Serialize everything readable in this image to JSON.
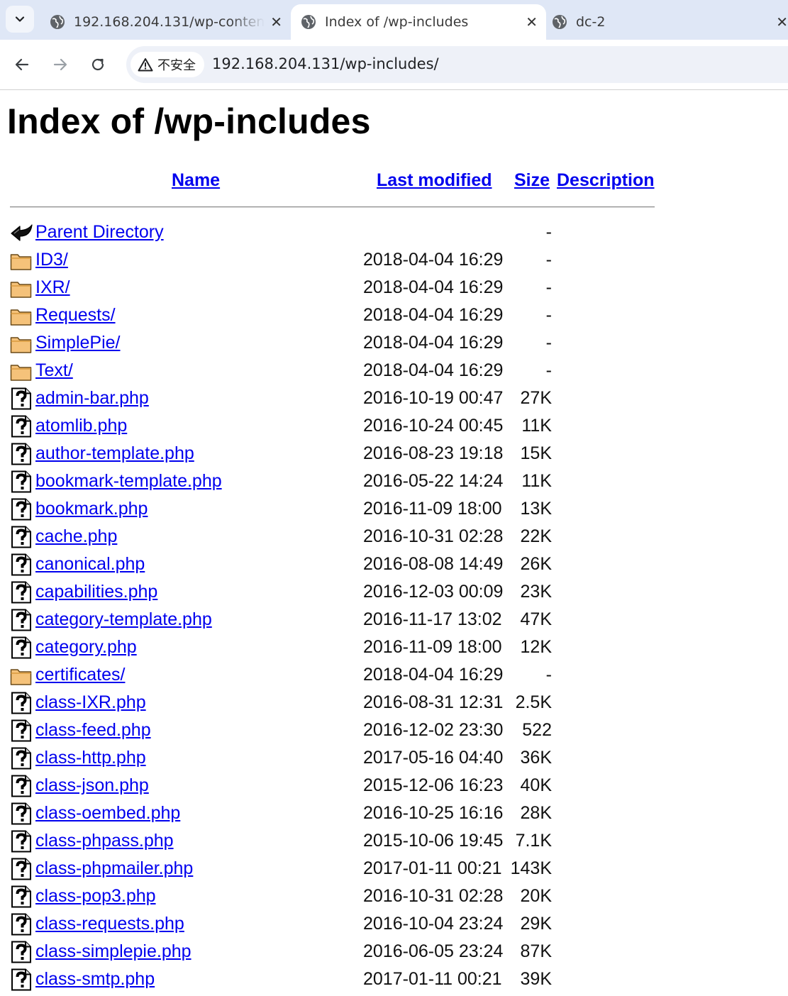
{
  "browser": {
    "tabs": [
      {
        "title": "192.168.204.131/wp-content",
        "active": false
      },
      {
        "title": "Index of /wp-includes",
        "active": true
      },
      {
        "title": "dc-2",
        "active": false
      }
    ],
    "security_label": "不安全",
    "url": "192.168.204.131/wp-includes/"
  },
  "page": {
    "title": "Index of /wp-includes",
    "columns": {
      "name": "Name",
      "last_modified": "Last modified",
      "size": "Size",
      "description": "Description"
    },
    "rows": [
      {
        "icon": "back-icon",
        "name": "Parent Directory",
        "date": "",
        "size": "-"
      },
      {
        "icon": "folder-icon",
        "name": "ID3/",
        "date": "2018-04-04 16:29",
        "size": "-"
      },
      {
        "icon": "folder-icon",
        "name": "IXR/",
        "date": "2018-04-04 16:29",
        "size": "-"
      },
      {
        "icon": "folder-icon",
        "name": "Requests/",
        "date": "2018-04-04 16:29",
        "size": "-"
      },
      {
        "icon": "folder-icon",
        "name": "SimplePie/",
        "date": "2018-04-04 16:29",
        "size": "-"
      },
      {
        "icon": "folder-icon",
        "name": "Text/",
        "date": "2018-04-04 16:29",
        "size": "-"
      },
      {
        "icon": "unknown-file-icon",
        "name": "admin-bar.php",
        "date": "2016-10-19 00:47",
        "size": "27K"
      },
      {
        "icon": "unknown-file-icon",
        "name": "atomlib.php",
        "date": "2016-10-24 00:45",
        "size": "11K"
      },
      {
        "icon": "unknown-file-icon",
        "name": "author-template.php",
        "date": "2016-08-23 19:18",
        "size": "15K"
      },
      {
        "icon": "unknown-file-icon",
        "name": "bookmark-template.php",
        "date": "2016-05-22 14:24",
        "size": "11K"
      },
      {
        "icon": "unknown-file-icon",
        "name": "bookmark.php",
        "date": "2016-11-09 18:00",
        "size": "13K"
      },
      {
        "icon": "unknown-file-icon",
        "name": "cache.php",
        "date": "2016-10-31 02:28",
        "size": "22K"
      },
      {
        "icon": "unknown-file-icon",
        "name": "canonical.php",
        "date": "2016-08-08 14:49",
        "size": "26K"
      },
      {
        "icon": "unknown-file-icon",
        "name": "capabilities.php",
        "date": "2016-12-03 00:09",
        "size": "23K"
      },
      {
        "icon": "unknown-file-icon",
        "name": "category-template.php",
        "date": "2016-11-17 13:02",
        "size": "47K"
      },
      {
        "icon": "unknown-file-icon",
        "name": "category.php",
        "date": "2016-11-09 18:00",
        "size": "12K"
      },
      {
        "icon": "folder-icon",
        "name": "certificates/",
        "date": "2018-04-04 16:29",
        "size": "-"
      },
      {
        "icon": "unknown-file-icon",
        "name": "class-IXR.php",
        "date": "2016-08-31 12:31",
        "size": "2.5K"
      },
      {
        "icon": "unknown-file-icon",
        "name": "class-feed.php",
        "date": "2016-12-02 23:30",
        "size": "522"
      },
      {
        "icon": "unknown-file-icon",
        "name": "class-http.php",
        "date": "2017-05-16 04:40",
        "size": "36K"
      },
      {
        "icon": "unknown-file-icon",
        "name": "class-json.php",
        "date": "2015-12-06 16:23",
        "size": "40K"
      },
      {
        "icon": "unknown-file-icon",
        "name": "class-oembed.php",
        "date": "2016-10-25 16:16",
        "size": "28K"
      },
      {
        "icon": "unknown-file-icon",
        "name": "class-phpass.php",
        "date": "2015-10-06 19:45",
        "size": "7.1K"
      },
      {
        "icon": "unknown-file-icon",
        "name": "class-phpmailer.php",
        "date": "2017-01-11 00:21",
        "size": "143K"
      },
      {
        "icon": "unknown-file-icon",
        "name": "class-pop3.php",
        "date": "2016-10-31 02:28",
        "size": "20K"
      },
      {
        "icon": "unknown-file-icon",
        "name": "class-requests.php",
        "date": "2016-10-04 23:24",
        "size": "29K"
      },
      {
        "icon": "unknown-file-icon",
        "name": "class-simplepie.php",
        "date": "2016-06-05 23:24",
        "size": "87K"
      },
      {
        "icon": "unknown-file-icon",
        "name": "class-smtp.php",
        "date": "2017-01-11 00:21",
        "size": "39K"
      }
    ]
  },
  "colors": {
    "link": "#0000ee",
    "tabstrip": "#dfe7f6",
    "omnibox": "#eef1f8"
  }
}
